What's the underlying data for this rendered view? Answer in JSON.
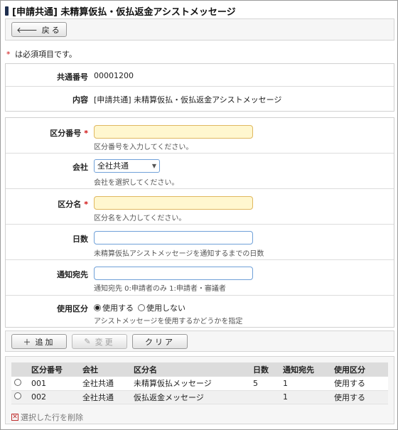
{
  "title": "[申請共通] 未精算仮払・仮払返金アシストメッセージ",
  "toolbar": {
    "back_icon": "arrow-left-icon",
    "back_label": "戻る"
  },
  "required_note": {
    "star": "*",
    "text": "は必須項目です。"
  },
  "info": {
    "common_no_label": "共通番号",
    "common_no_value": "00001200",
    "content_label": "内容",
    "content_value": "[申請共通] 未精算仮払・仮払返金アシストメッセージ"
  },
  "form": {
    "kubun_no": {
      "label": "区分番号",
      "required_star": "*",
      "value": "",
      "hint": "区分番号を入力してください。"
    },
    "company": {
      "label": "会社",
      "selected": "全社共通",
      "hint": "会社を選択してください。"
    },
    "kubun_name": {
      "label": "区分名",
      "required_star": "*",
      "value": "",
      "hint": "区分名を入力してください。"
    },
    "days": {
      "label": "日数",
      "value": "",
      "hint": "未精算仮払アシストメッセージを通知するまでの日数"
    },
    "notify_to": {
      "label": "通知宛先",
      "value": "",
      "hint": "通知宛先 0:申請者のみ 1:申請者・審議者"
    },
    "usage": {
      "label": "使用区分",
      "options": [
        "使用する",
        "使用しない"
      ],
      "selected": "使用する",
      "hint": "アシストメッセージを使用するかどうかを指定"
    }
  },
  "actions": {
    "add_label": "追加",
    "edit_label": "変更",
    "clear_label": "クリア"
  },
  "table": {
    "headers": [
      "",
      "区分番号",
      "会社",
      "区分名",
      "日数",
      "通知宛先",
      "使用区分"
    ],
    "rows": [
      {
        "no": "001",
        "company": "全社共通",
        "name": "未精算仮払メッセージ",
        "days": "5",
        "notify": "1",
        "usage": "使用する"
      },
      {
        "no": "002",
        "company": "全社共通",
        "name": "仮払返金メッセージ",
        "days": "",
        "notify": "1",
        "usage": "使用する"
      }
    ]
  },
  "delete_label": "選択した行を削除",
  "colors": {
    "accent": "#1f2f4f",
    "required": "#d01010",
    "required_field_bg": "#fff7cf",
    "input_border": "#6fa0d8"
  }
}
